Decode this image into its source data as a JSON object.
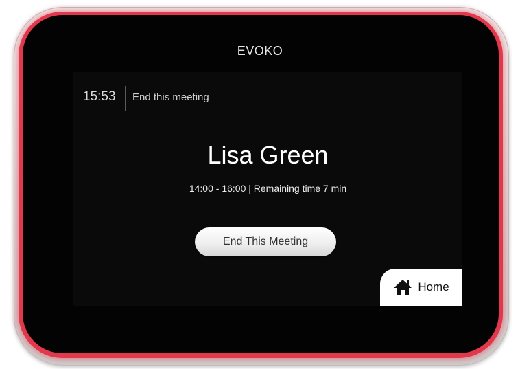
{
  "device": {
    "brand": "EVOKO",
    "accent_color": "#e2384b"
  },
  "header": {
    "clock": "15:53",
    "end_link_label": "End this meeting"
  },
  "meeting": {
    "organizer": "Lisa Green",
    "time_range": "14:00 - 16:00 | Remaining time  7 min"
  },
  "actions": {
    "end_button_label": "End This Meeting",
    "home_label": "Home",
    "home_icon": "home-icon"
  }
}
